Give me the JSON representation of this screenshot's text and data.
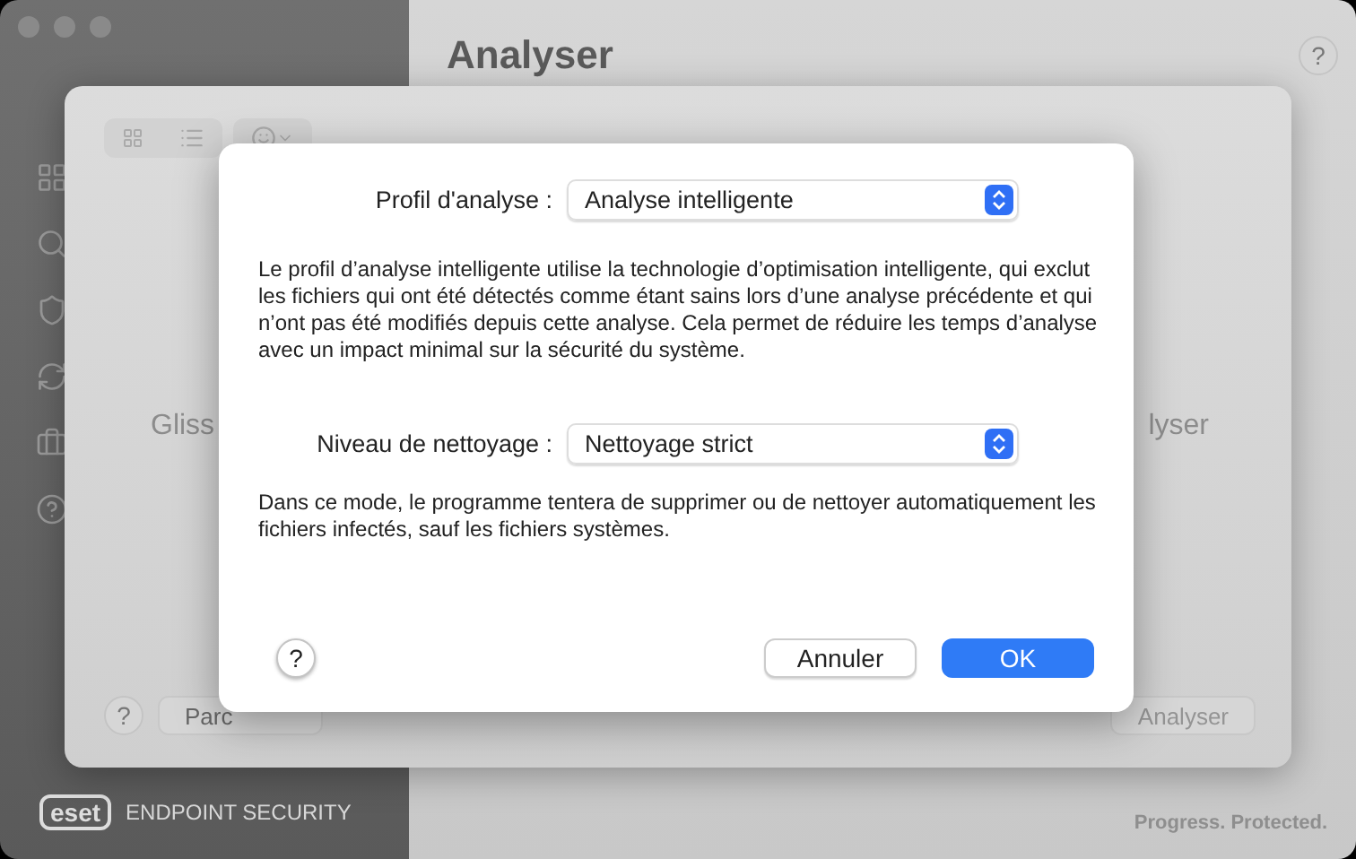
{
  "app": {
    "title": "Analyser",
    "help": "?",
    "brand_logo": "eset",
    "brand_name": "ENDPOINT SECURITY",
    "tagline": "Progress. Protected."
  },
  "sheet": {
    "drop_hint_start": "Gliss",
    "drop_hint_end": "lyser",
    "help": "?",
    "browse_button": "Parc",
    "analyse_button": {
      "label": "Analyser",
      "disabled": true
    }
  },
  "dialog": {
    "fields": [
      {
        "label": "Profil d'analyse :",
        "value": "Analyse intelligente",
        "description": "Le profil d’analyse intelligente utilise la technologie d’optimisation intelligente, qui exclut les fichiers qui ont été détectés comme étant sains lors d’une analyse précédente et qui n’ont pas été modifiés depuis cette analyse. Cela permet de réduire les temps d’analyse avec un impact minimal sur la sécurité du système."
      },
      {
        "label": "Niveau de nettoyage :",
        "value": "Nettoyage strict",
        "description": "Dans ce mode, le programme tentera de supprimer ou de nettoyer automatiquement les fichiers infectés, sauf les fichiers systèmes."
      }
    ],
    "help": "?",
    "buttons": [
      {
        "label": "Annuler",
        "kind": "secondary"
      },
      {
        "label": "OK",
        "kind": "primary"
      }
    ]
  }
}
